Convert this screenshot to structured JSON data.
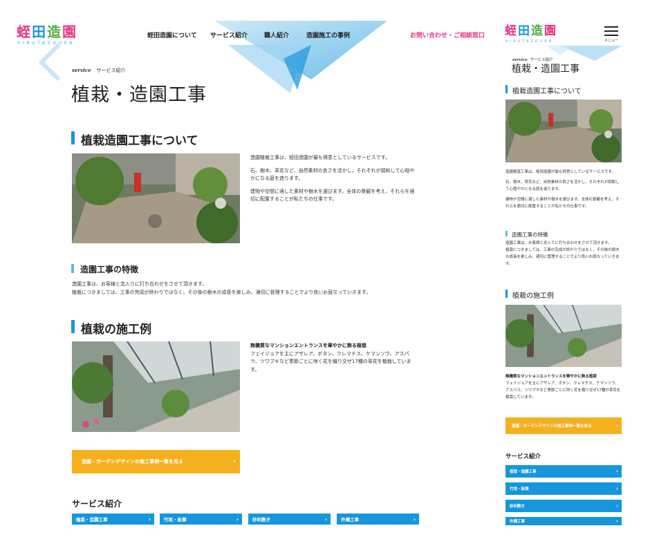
{
  "brand": {
    "logo_chars": [
      "蛭",
      "田",
      "造",
      "園"
    ],
    "logo_sub": "HIRUTAZOUEN",
    "colors": {
      "accent_blue": "#1596dd",
      "cta_yellow": "#f5b01e",
      "contact_pink": "#e8338a"
    }
  },
  "nav": {
    "items": [
      "蛭田造園について",
      "サービス紹介",
      "職人紹介",
      "造園施工の事例"
    ],
    "contact": "お問い合わせ・ご相談窓口",
    "menu_label": "メニュー"
  },
  "breadcrumb": {
    "script": "service",
    "current": "サービス紹介"
  },
  "page": {
    "title": "植栽・造園工事",
    "about": {
      "heading": "植栽造園工事について",
      "paragraphs": [
        "造園植栽工事は、蛭田造園が最も得意としているサービスです。",
        "石、樹木、草花など、自然素材の良さを活かし、それぞれが調和して心穏やかになる庭を造ります。",
        "建物や空間に適した素材や樹木を選びます。全体の景観を考え、それらを適切に配置することが私たちの仕事です。"
      ]
    },
    "feature": {
      "heading": "造園工事の特徴",
      "paragraphs": [
        "造園工事は、お客様と念入りに打ち合わせをさせて頂きます。",
        "植栽につきましては、工事の完成が終わりではなく、その後の樹木の成長を楽しみ、適切に管理することでより良いお庭なっていきます。"
      ]
    },
    "cases": {
      "heading": "植栽の施工例",
      "case_title": "無機質なマンションエントランスを華やかに飾る植栽",
      "case_text": "フェイジョアを主にアザレア、ボタン、クレマチス、ケマンソウ、アスパラ、ツワブキなど季節ごとに咲く花を織り交ぜ17種の草花を植栽しています。",
      "cta": "造園・ガーデンデザインの施工事例一覧を見る"
    },
    "services": {
      "heading": "サービス紹介",
      "buttons": [
        "植栽・造園工事",
        "竹垣・板塀",
        "砂利敷き",
        "外構工事"
      ]
    }
  },
  "icons": {
    "chevron": "›",
    "burger": "hamburger-menu-icon"
  }
}
